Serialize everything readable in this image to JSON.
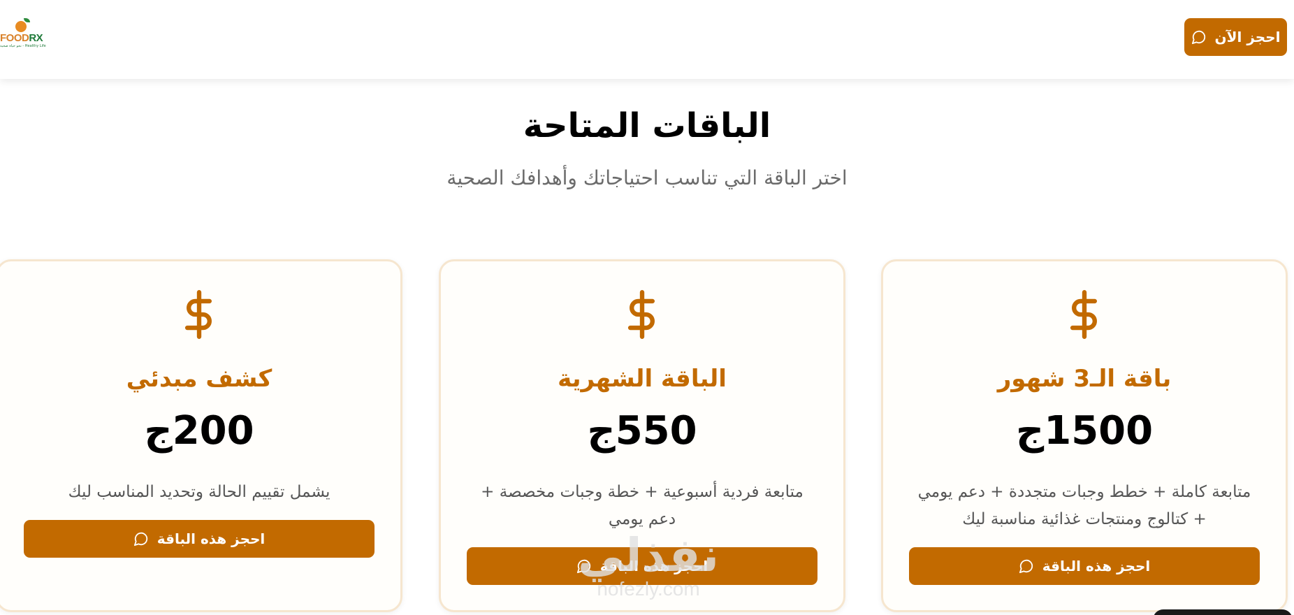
{
  "header": {
    "logo": {
      "brand_food": "FOOD",
      "brand_rx": "RX",
      "tagline": "نحو حياة صحية - Healthy Life"
    },
    "book_now_label": "احجز الآن"
  },
  "section": {
    "title": "الباقات المتاحة",
    "subtitle": "اختر الباقة التي تناسب احتياجاتك وأهدافك الصحية"
  },
  "packages": [
    {
      "name": "باقة الـ3 شهور",
      "price": "1500ج",
      "description": "متابعة كاملة + خطط وجبات متجددة + دعم يومي + كتالوج ومنتجات غذائية مناسبة ليك",
      "button_label": "احجز هذه الباقة"
    },
    {
      "name": "الباقة الشهرية",
      "price": "550ج",
      "description": "متابعة فردية أسبوعية + خطة وجبات مخصصة + دعم يومي",
      "button_label": "احجز هذه الباقة"
    },
    {
      "name": "كشف مبدئي",
      "price": "200ج",
      "description": "يشمل تقييم الحالة وتحديد المناسب ليك",
      "button_label": "احجز هذه الباقة"
    }
  ],
  "watermark": {
    "arabic": "نفذلي",
    "latin": "nofezly.com"
  },
  "icons": {
    "card_icon": "dollar-icon",
    "button_icon": "chat-bubble-icon"
  },
  "colors": {
    "accent": "#c26a00",
    "card_border": "#f6e6cf",
    "subtitle": "#6b6b6b"
  }
}
